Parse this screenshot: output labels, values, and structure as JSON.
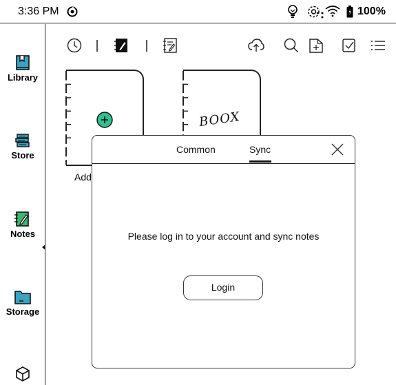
{
  "status_bar": {
    "time": "3:36 PM",
    "battery_percent": "100%",
    "icons": [
      "sync-status-icon",
      "bulb-icon",
      "refresh-icon",
      "wifi-icon",
      "battery-icon"
    ]
  },
  "sidebar": {
    "items": [
      {
        "label": "Library",
        "icon": "library-icon"
      },
      {
        "label": "Store",
        "icon": "store-icon"
      },
      {
        "label": "Notes",
        "icon": "notes-icon",
        "active": true
      },
      {
        "label": "Storage",
        "icon": "storage-icon"
      },
      {
        "label": "",
        "icon": "apps-cube-icon"
      }
    ]
  },
  "toolbar": {
    "icons": [
      "recent-clock-icon",
      "handwriting-notes-icon",
      "text-notes-icon",
      "cloud-sync-icon",
      "search-icon",
      "new-folder-icon",
      "select-checkbox-icon",
      "view-list-icon"
    ]
  },
  "notebooks": {
    "add_caption": "Add",
    "sample_handwriting": "BOOX"
  },
  "dialog": {
    "tabs": [
      {
        "label": "Common",
        "active": false
      },
      {
        "label": "Sync",
        "active": true
      }
    ],
    "message": "Please log in to your account and sync notes",
    "login_label": "Login"
  }
}
